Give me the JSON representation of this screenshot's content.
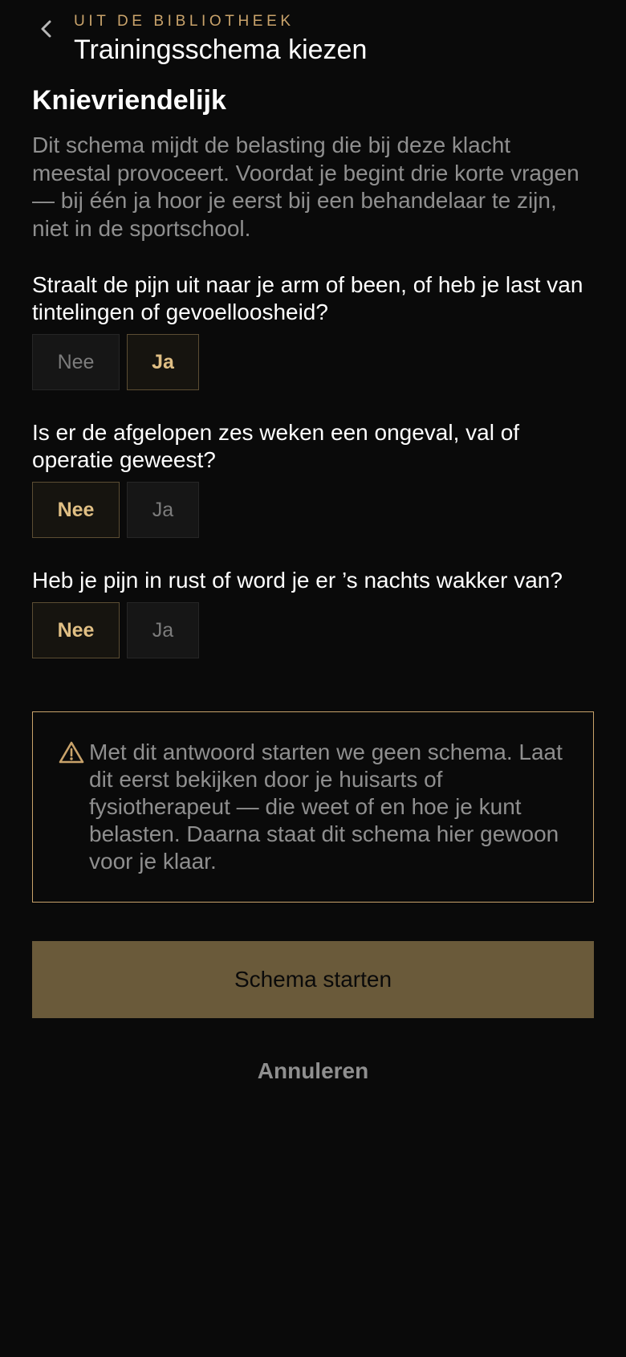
{
  "header": {
    "eyebrow": "UIT DE BIBLIOTHEEK",
    "title": "Trainingsschema kiezen",
    "back_icon": "chevron-left-icon"
  },
  "schema": {
    "title": "Knievriendelijk",
    "intro": "Dit schema mijdt de belasting die bij deze klacht meestal provoceert. Voordat je begint drie korte vragen — bij één ja hoor je eerst bij een behandelaar te zijn, niet in de sportschool."
  },
  "questions": [
    {
      "text": "Straalt de pijn uit naar je arm of been, of heb je last van tintelingen of gevoelloosheid?",
      "options": [
        "Nee",
        "Ja"
      ],
      "selected": "Ja"
    },
    {
      "text": "Is er de afgelopen zes weken een ongeval, val of operatie geweest?",
      "options": [
        "Nee",
        "Ja"
      ],
      "selected": "Nee"
    },
    {
      "text": "Heb je pijn in rust of word je er ’s nachts wakker van?",
      "options": [
        "Nee",
        "Ja"
      ],
      "selected": "Nee"
    }
  ],
  "warning": {
    "icon": "warning-triangle-icon",
    "text": "Met dit antwoord starten we geen schema. Laat dit eerst bekijken door je huisarts of fysiotherapeut — die weet of en hoe je kunt belasten. Daarna staat dit schema hier gewoon voor je klaar."
  },
  "actions": {
    "start_label": "Schema starten",
    "cancel_label": "Annuleren"
  },
  "colors": {
    "background": "#0a0a0a",
    "accent": "#c9a36b",
    "button_fill": "#6a5a3a",
    "muted_text": "#8f8f8f"
  }
}
